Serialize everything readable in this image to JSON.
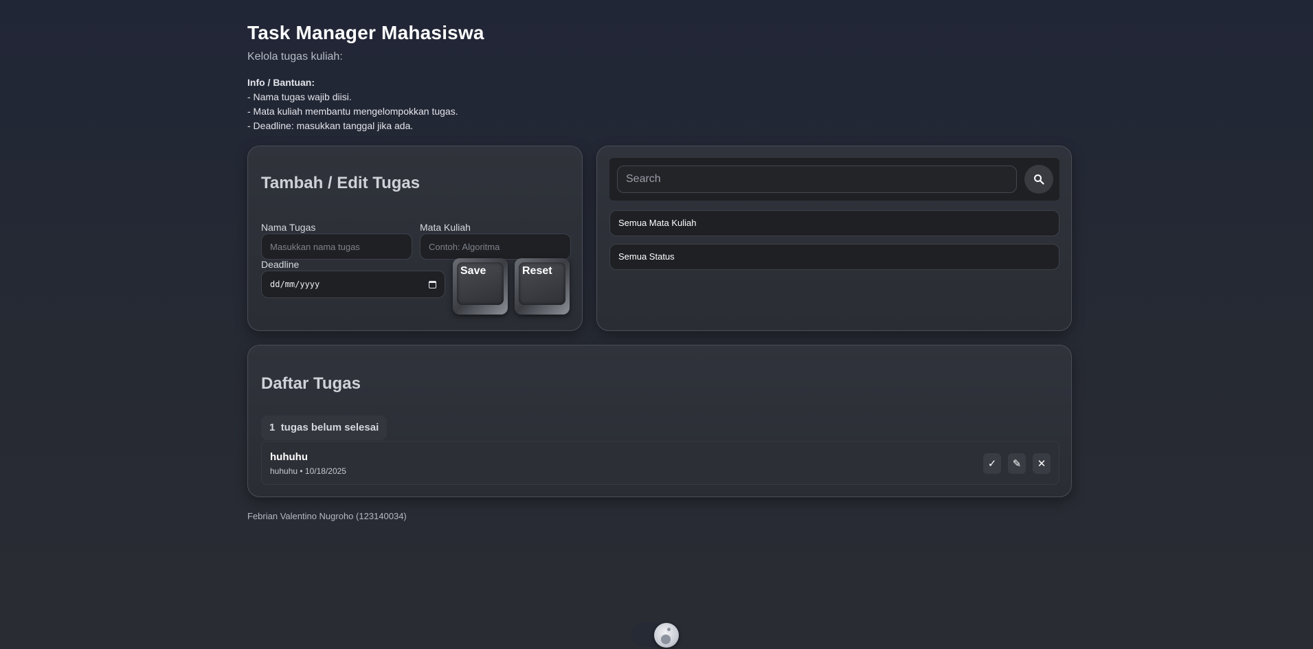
{
  "header": {
    "title": "Task Manager Mahasiswa",
    "subtitle": "Kelola tugas kuliah:",
    "info_title": "Info / Bantuan:",
    "info_lines": [
      "- Nama tugas wajib diisi.",
      "- Mata kuliah membantu mengelompokkan tugas.",
      "- Deadline: masukkan tanggal jika ada."
    ]
  },
  "form": {
    "title": "Tambah / Edit Tugas",
    "task_name_label": "Nama Tugas",
    "task_name_placeholder": "Masukkan nama tugas",
    "course_label": "Mata Kuliah",
    "course_placeholder": "Contoh: Algoritma",
    "deadline_label": "Deadline",
    "deadline_value": "dd/mm/yyyy",
    "save_label": "Save",
    "reset_label": "Reset"
  },
  "filter": {
    "search_placeholder": "Search",
    "course_select": "Semua Mata Kuliah",
    "status_select": "Semua Status"
  },
  "list": {
    "title": "Daftar Tugas",
    "pending_count": "1",
    "pending_label": "tugas belum selesai",
    "tasks": [
      {
        "name": "huhuhu",
        "meta": "huhuhu • 10/18/2025"
      }
    ],
    "actions": {
      "complete": "✓",
      "edit": "✎",
      "delete": "✕"
    }
  },
  "footer": {
    "text": "Febrian Valentino Nugroho (123140034)"
  },
  "icons": {
    "search": "search-icon",
    "calendar": "calendar-icon",
    "complete": "check-icon",
    "edit": "pencil-icon",
    "delete": "close-icon",
    "theme": "moon-icon"
  },
  "colors": {
    "background": "#232735",
    "card": "#2d3037",
    "input": "#1f2024",
    "text": "#ffffff"
  }
}
